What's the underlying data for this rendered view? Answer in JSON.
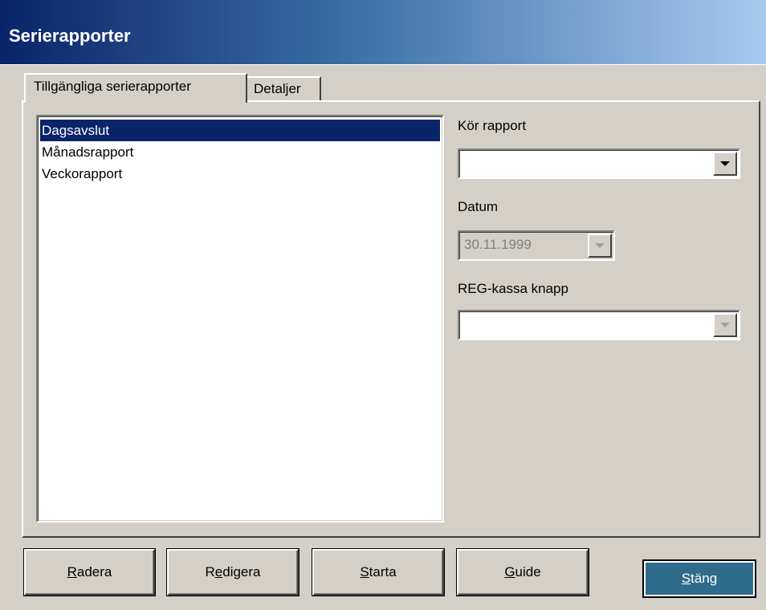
{
  "window": {
    "title": "Serierapporter"
  },
  "tabs": [
    {
      "label": "Tillgängliga serierapporter",
      "active": true
    },
    {
      "label": "Detaljer",
      "active": false
    }
  ],
  "report_list": {
    "items": [
      {
        "label": "Dagsavslut",
        "selected": true
      },
      {
        "label": "Månadsrapport",
        "selected": false
      },
      {
        "label": "Veckorapport",
        "selected": false
      }
    ]
  },
  "fields": {
    "run_report": {
      "label": "Kör rapport",
      "value": ""
    },
    "date": {
      "label": "Datum",
      "value": "30.11.1999",
      "disabled": true
    },
    "reg_button": {
      "label": "REG-kassa knapp",
      "value": "",
      "disabled": true
    }
  },
  "buttons": {
    "delete": {
      "accel": "R",
      "rest": "adera"
    },
    "edit": {
      "pre": "R",
      "accel": "e",
      "rest": "digera"
    },
    "start": {
      "accel": "S",
      "rest": "tarta"
    },
    "guide": {
      "accel": "G",
      "rest": "uide"
    },
    "close": {
      "accel": "S",
      "rest": "täng"
    }
  },
  "colors": {
    "title_gradient_start": "#0a246a",
    "title_gradient_end": "#a6caf0",
    "selection": "#0a246a",
    "default_button": "#2f6b8a"
  }
}
